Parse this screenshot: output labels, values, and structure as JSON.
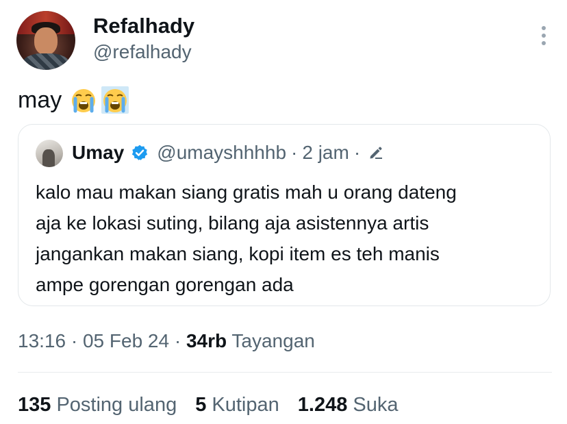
{
  "author": {
    "display_name": "Refalhady",
    "handle": "@refalhady"
  },
  "tweet": {
    "text": "may",
    "emojis": [
      "loudly-crying-face",
      "loudly-crying-face"
    ]
  },
  "quoted_tweet": {
    "display_name": "Umay",
    "handle": "@umayshhhhb",
    "separator": "·",
    "time": "2 jam",
    "lines": [
      "kalo mau makan siang gratis mah u orang dateng",
      "aja ke lokasi suting, bilang aja asistennya artis",
      "jangankan makan siang, kopi item es teh manis",
      "ampe gorengan gorengan ada"
    ]
  },
  "meta": {
    "time": "13:16",
    "separator": "·",
    "date": "05 Feb 24",
    "views_count": "34rb",
    "views_label": "Tayangan"
  },
  "stats": {
    "reposts_count": "135",
    "reposts_label": "Posting ulang",
    "quotes_count": "5",
    "quotes_label": "Kutipan",
    "likes_count": "1.248",
    "likes_label": "Suka"
  },
  "colors": {
    "text_primary": "#0f1419",
    "text_secondary": "#536471",
    "verified_blue": "#1d9bf0",
    "border": "#e3e7ea"
  }
}
